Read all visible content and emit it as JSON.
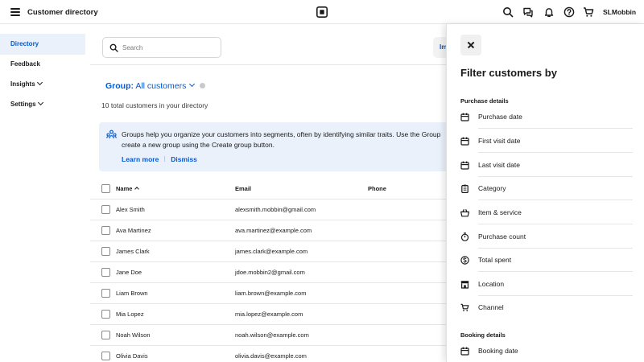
{
  "header": {
    "menu_icon": "hamburger-menu-icon",
    "title": "Customer directory",
    "logo_icon": "square-logo-icon",
    "icons": [
      "search-icon",
      "messages-icon",
      "bell-icon",
      "help-icon",
      "cart-icon"
    ],
    "username": "SLMobbin"
  },
  "sidebar": {
    "items": [
      {
        "label": "Directory",
        "active": true
      },
      {
        "label": "Feedback"
      },
      {
        "label": "Insights",
        "dropdown": true
      },
      {
        "label": "Settings",
        "dropdown": true
      }
    ]
  },
  "main": {
    "search_placeholder": "Search",
    "import_label": "Im",
    "group_label": "Group:",
    "group_value": "All customers",
    "total_text": "10 total customers in your directory",
    "banner": {
      "text": "Groups help you organize your customers into segments, often by identifying similar traits. Use the Group\ncreate a new group using the Create group button.",
      "learn_more": "Learn more",
      "dismiss": "Dismiss",
      "icon": "groups-icon"
    },
    "table": {
      "headers": {
        "name": "Name",
        "email": "Email",
        "phone": "Phone"
      },
      "rows": [
        {
          "name": "Alex Smith",
          "email": "alexsmith.mobbin@gmail.com",
          "phone": ""
        },
        {
          "name": "Ava Martinez",
          "email": "ava.martinez@example.com",
          "phone": ""
        },
        {
          "name": "James Clark",
          "email": "james.clark@example.com",
          "phone": ""
        },
        {
          "name": "Jane Doe",
          "email": "jdoe.mobbin2@gmail.com",
          "phone": ""
        },
        {
          "name": "Liam Brown",
          "email": "liam.brown@example.com",
          "phone": ""
        },
        {
          "name": "Mia Lopez",
          "email": "mia.lopez@example.com",
          "phone": ""
        },
        {
          "name": "Noah Wilson",
          "email": "noah.wilson@example.com",
          "phone": ""
        },
        {
          "name": "Olivia Davis",
          "email": "olivia.davis@example.com",
          "phone": ""
        }
      ]
    }
  },
  "drawer": {
    "title": "Filter customers by",
    "sections": [
      {
        "heading": "Purchase details",
        "items": [
          {
            "label": "Purchase date",
            "icon": "calendar-icon"
          },
          {
            "label": "First visit date",
            "icon": "calendar-icon"
          },
          {
            "label": "Last visit date",
            "icon": "calendar-icon"
          },
          {
            "label": "Category",
            "icon": "clipboard-icon"
          },
          {
            "label": "Item & service",
            "icon": "basket-icon"
          },
          {
            "label": "Purchase count",
            "icon": "stopwatch-icon"
          },
          {
            "label": "Total spent",
            "icon": "dollar-icon"
          },
          {
            "label": "Location",
            "icon": "storefront-icon"
          },
          {
            "label": "Channel",
            "icon": "cart-icon"
          }
        ]
      },
      {
        "heading": "Booking details",
        "items": [
          {
            "label": "Booking date",
            "icon": "calendar-icon"
          }
        ]
      }
    ]
  },
  "colors": {
    "accent": "#005ad9",
    "active_bg": "#eaf1fb",
    "banner_bg": "#eaf1fb",
    "divider": "#e6e6e6"
  }
}
